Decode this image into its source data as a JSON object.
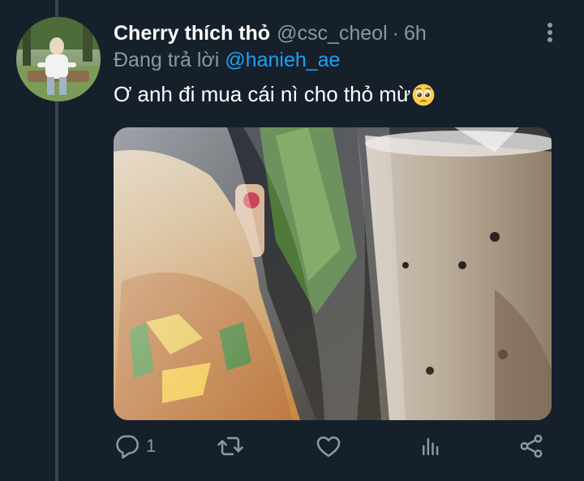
{
  "tweet": {
    "display_name": "Cherry thích thỏ",
    "handle": "@csc_cheol",
    "separator": "·",
    "time": "6h",
    "reply_prefix": "Đang trả lời",
    "reply_to": "@hanieh_ae",
    "text": "Ơ anh đi mua cái nì cho thỏ mừ",
    "emoji": "pleading-face-emoji"
  },
  "actions": {
    "reply_count": "1",
    "retweet_icon": "retweet-icon",
    "like_icon": "heart-icon",
    "analytics_icon": "analytics-icon",
    "share_icon": "share-icon"
  },
  "colors": {
    "background": "#15202b",
    "primary_text": "#ffffff",
    "secondary_text": "#8899a6",
    "link": "#1da1f2",
    "thread_line": "#38444d"
  }
}
